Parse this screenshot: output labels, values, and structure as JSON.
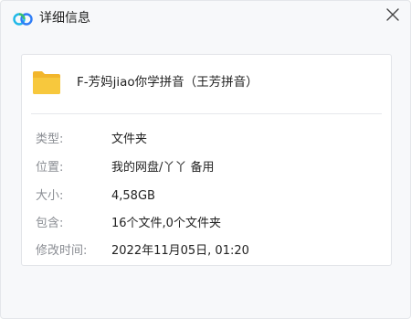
{
  "window": {
    "title": "详细信息",
    "app_icon": "baidu-netdisk-cloud-icon",
    "close_icon": "close-icon"
  },
  "file": {
    "name": "F-芳妈jiao你学拼音（王芳拼音）",
    "icon": "folder-icon",
    "icon_color": "#f7c23d"
  },
  "properties": [
    {
      "label": "类型:",
      "value": "文件夹"
    },
    {
      "label": "位置:",
      "value": "我的网盘/丫丫 备用"
    },
    {
      "label": "大小:",
      "value": "4,58GB"
    },
    {
      "label": "包含:",
      "value": "16个文件,0个文件夹"
    },
    {
      "label": "修改时间:",
      "value": "2022年11月05日, 01:20"
    }
  ],
  "colors": {
    "accent_blue": "#2f7df6",
    "accent_cyan": "#1fb8e8",
    "label_gray": "#8a8d93"
  }
}
